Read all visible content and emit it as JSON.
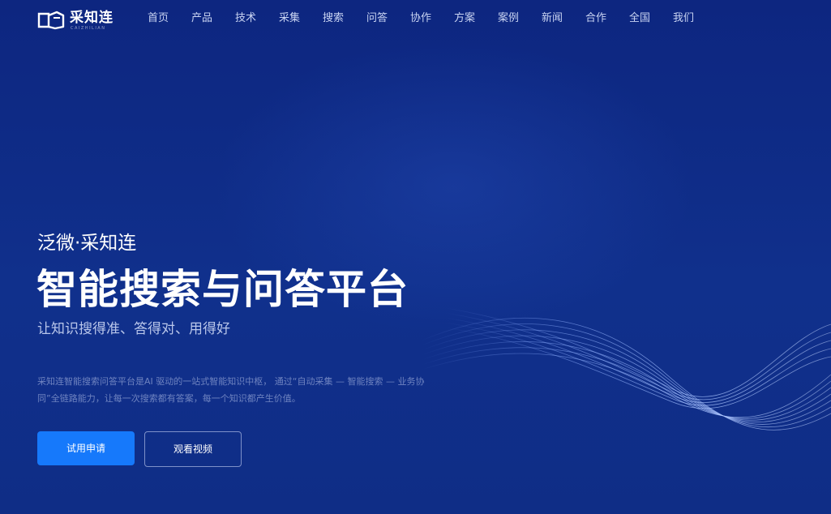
{
  "header": {
    "logo_text": "采知连",
    "logo_sub": "CAIZHILIAN",
    "nav": [
      {
        "label": "首页"
      },
      {
        "label": "产品"
      },
      {
        "label": "技术"
      },
      {
        "label": "采集"
      },
      {
        "label": "搜索"
      },
      {
        "label": "问答"
      },
      {
        "label": "协作"
      },
      {
        "label": "方案"
      },
      {
        "label": "案例"
      },
      {
        "label": "新闻"
      },
      {
        "label": "合作"
      },
      {
        "label": "全国"
      },
      {
        "label": "我们"
      }
    ]
  },
  "hero": {
    "subtitle": "泛微·采知连",
    "title": "智能搜索与问答平台",
    "slogan": "让知识搜得准、答得对、用得好",
    "description": "采知连智能搜索问答平台是AI 驱动的一站式智能知识中枢， 通过“自动采集 — 智能搜索 — 业务协同”全链路能力，让每一次搜索都有答案，每一个知识都产生价值。",
    "primary_button": "试用申请",
    "secondary_button": "观看视频"
  },
  "colors": {
    "background": "#0f2a82",
    "primary_button": "#1679fb",
    "nav_text": "#c9d4f2"
  }
}
